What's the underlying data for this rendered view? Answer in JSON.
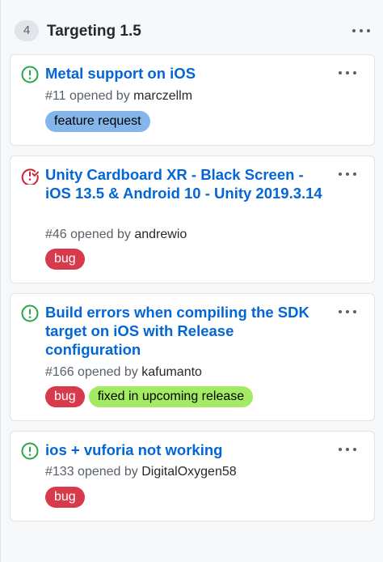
{
  "column": {
    "count": "4",
    "title": "Targeting 1.5",
    "menu_icon": "kebab-horizontal-icon"
  },
  "colors": {
    "open_issue": "#28a745",
    "closed_issue": "#cb2431",
    "link": "#0366d6",
    "feature_request": "#84b6eb",
    "bug": "#d73a4a",
    "fixed": "#a2eb62"
  },
  "cards": [
    {
      "status": "open",
      "icon": "issue-opened-icon",
      "title": "Metal support on iOS",
      "number": "#11",
      "opened_by": "opened by",
      "author": "marczellm",
      "labels": [
        {
          "name": "feature request",
          "color": "#84b6eb",
          "text_color": "#000000"
        }
      ]
    },
    {
      "status": "closed",
      "icon": "issue-closed-icon",
      "title": "Unity Cardboard XR - Black Screen - iOS 13.5 & Android 10 - Unity 2019.3.14",
      "number": "#46",
      "opened_by": "opened by",
      "author": "andrewio",
      "labels": [
        {
          "name": "bug",
          "color": "#d73a4a",
          "text_color": "#ffffff"
        }
      ]
    },
    {
      "status": "open",
      "icon": "issue-opened-icon",
      "title": "Build errors when compiling the SDK target on iOS with Release configuration",
      "number": "#166",
      "opened_by": "opened by",
      "author": "kafumanto",
      "labels": [
        {
          "name": "bug",
          "color": "#d73a4a",
          "text_color": "#ffffff"
        },
        {
          "name": "fixed in upcoming release",
          "color": "#a2eb62",
          "text_color": "#000000"
        }
      ]
    },
    {
      "status": "open",
      "icon": "issue-opened-icon",
      "title": "ios + vuforia not working",
      "number": "#133",
      "opened_by": "opened by",
      "author": "DigitalOxygen58",
      "labels": [
        {
          "name": "bug",
          "color": "#d73a4a",
          "text_color": "#ffffff"
        }
      ]
    }
  ]
}
